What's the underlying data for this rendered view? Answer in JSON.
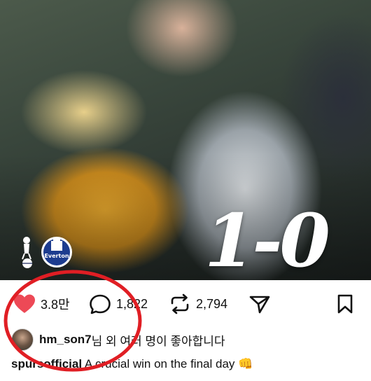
{
  "post": {
    "score_text": "1-0",
    "crest_left_name": "spurs-crest",
    "crest_right_text": "Everton"
  },
  "actions": {
    "likes_count": "3.8만",
    "comments_count": "1,822",
    "reposts_count": "2,794"
  },
  "liked_by": {
    "username": "hm_son7",
    "suffix": "님 외 여러 명이 좋아합니다"
  },
  "caption": {
    "username": "spursofficial",
    "text": "A crucial win on the final day 👊"
  },
  "colors": {
    "heart": "#ed4956",
    "annotation": "#e01e24",
    "text": "#111111"
  },
  "icons": [
    "heart-icon",
    "comment-icon",
    "repost-icon",
    "share-icon",
    "bookmark-icon"
  ]
}
